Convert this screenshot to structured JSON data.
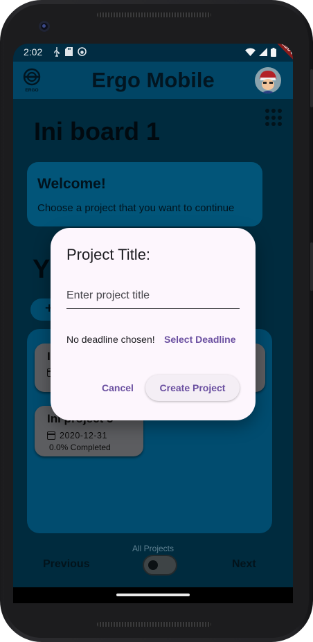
{
  "status_bar": {
    "time": "2:02",
    "left_icons": [
      "usb-icon",
      "sd-card-icon",
      "sync-icon"
    ],
    "right_icons": [
      "wifi-icon",
      "signal-icon",
      "battery-icon"
    ]
  },
  "debug_ribbon": "DEBUG",
  "app_bar": {
    "title": "Ergo Mobile",
    "logo_label": "ERGO",
    "avatar_icon": "avatar-icon"
  },
  "board": {
    "title": "Ini board 1",
    "menu_icon": "grid-dots-icon"
  },
  "welcome": {
    "title": "Welcome!",
    "subtitle": "Choose a project that you want to continue"
  },
  "projects_section": {
    "heading": "Y",
    "filter_icon": "add-icon",
    "cards": [
      {
        "name": "I",
        "date": "",
        "completed": ""
      },
      {
        "name": "",
        "date": "",
        "completed": ""
      },
      {
        "name": "Ini project 3",
        "date": "2020-12-31",
        "completed": "0.0% Completed"
      }
    ]
  },
  "pagination": {
    "label": "All Projects",
    "previous": "Previous",
    "next": "Next",
    "toggle_on": false
  },
  "dialog": {
    "title": "Project Title:",
    "input_placeholder": "Enter project title",
    "input_value": "",
    "deadline_status": "No deadline chosen!",
    "select_deadline": "Select Deadline",
    "cancel": "Cancel",
    "create": "Create Project"
  },
  "colors": {
    "app_bar": "#014565",
    "dialog_bg": "#fdf6fd",
    "accent": "#6a4fa0",
    "panel": "#014c6f"
  }
}
